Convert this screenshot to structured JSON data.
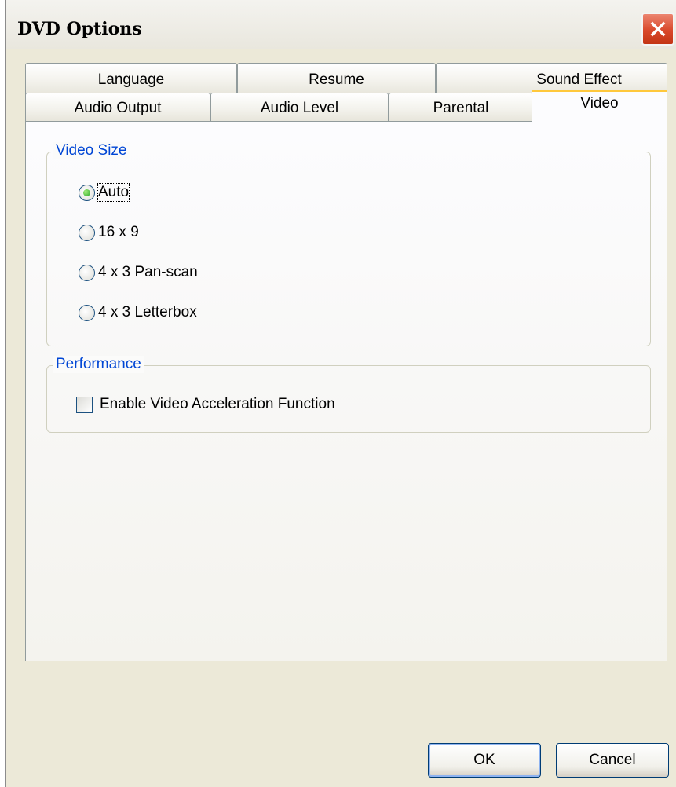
{
  "window": {
    "title": "DVD Options"
  },
  "tabs": {
    "back_row": [
      "Language",
      "Resume",
      "Sound Effect"
    ],
    "front_row": [
      "Audio Output",
      "Audio Level",
      "Parental",
      "Video"
    ],
    "active": "Video"
  },
  "video_size": {
    "label": "Video Size",
    "options": [
      "Auto",
      "16 x 9",
      "4 x 3 Pan-scan",
      "4 x 3 Letterbox"
    ],
    "selected": "Auto"
  },
  "performance": {
    "label": "Performance",
    "checkbox_label": "Enable Video Acceleration Function",
    "checked": false
  },
  "buttons": {
    "ok": "OK",
    "cancel": "Cancel"
  },
  "icons": {
    "close": "close-icon"
  },
  "colors": {
    "group_label": "#0046d5",
    "close_button": "#d9482b",
    "active_tab_accent": "#ffc83c"
  }
}
